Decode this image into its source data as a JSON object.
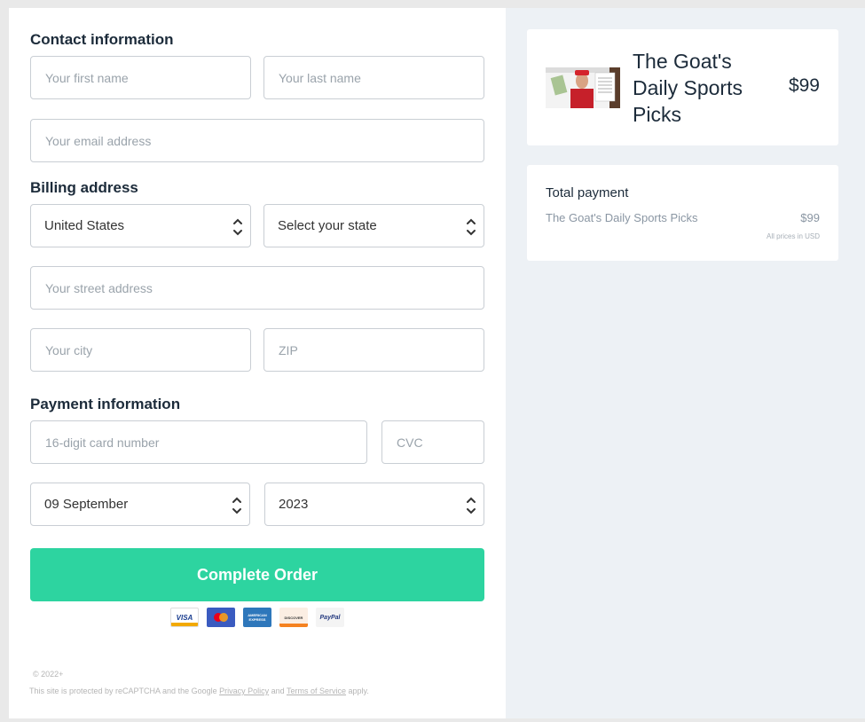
{
  "contact": {
    "title": "Contact information",
    "first_name_placeholder": "Your first name",
    "last_name_placeholder": "Your last name",
    "email_placeholder": "Your email address"
  },
  "billing": {
    "title": "Billing address",
    "country_value": "United States",
    "state_value": "Select your state",
    "street_placeholder": "Your street address",
    "city_placeholder": "Your city",
    "zip_placeholder": "ZIP"
  },
  "payment": {
    "title": "Payment information",
    "card_placeholder": "16-digit card number",
    "cvc_placeholder": "CVC",
    "month_value": "09 September",
    "year_value": "2023",
    "cards": [
      {
        "name": "VISA",
        "icon": "visa-icon"
      },
      {
        "name": "",
        "icon": "mastercard-icon"
      },
      {
        "name": "AMERICAN EXPRESS",
        "icon": "amex-icon"
      },
      {
        "name": "DISCOVER",
        "icon": "discover-icon"
      },
      {
        "name": "PayPal",
        "icon": "paypal-icon"
      }
    ]
  },
  "submit_label": "Complete Order",
  "footer": {
    "copyright": "© 2022+",
    "legal_prefix": "This site is protected by reCAPTCHA and the Google ",
    "privacy_link": "Privacy Policy",
    "legal_and": " and ",
    "terms_link": "Terms of Service",
    "legal_suffix": " apply."
  },
  "product": {
    "name": "The Goat's Daily Sports Picks",
    "price": "$99"
  },
  "summary": {
    "title": "Total payment",
    "item_name": "The Goat's Daily Sports Picks",
    "item_price": "$99",
    "note": "All prices in USD"
  },
  "colors": {
    "accent": "#2dd4a0",
    "text": "#1c2b3a",
    "muted": "#8a96a3"
  }
}
